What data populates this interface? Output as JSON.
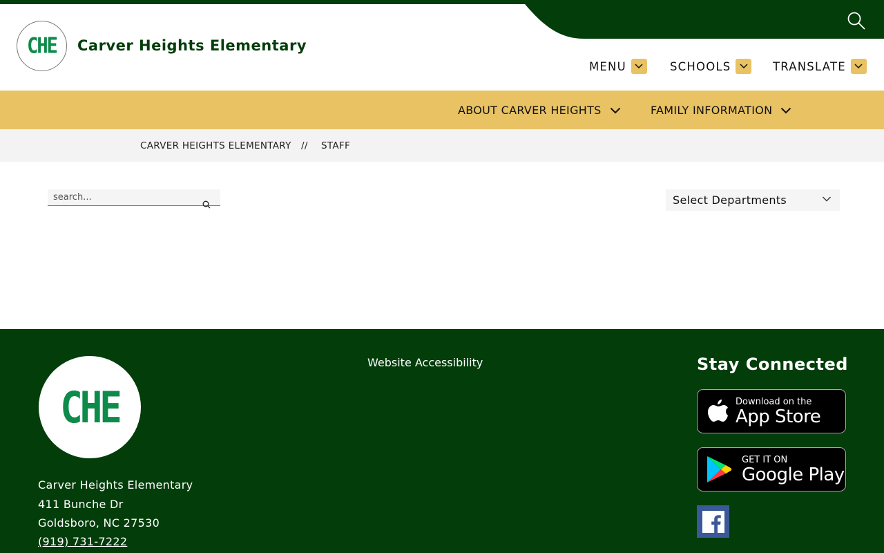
{
  "header": {
    "logo_text": "CHE",
    "school_name": "Carver Heights Elementary",
    "nav": [
      {
        "label": "MENU"
      },
      {
        "label": "SCHOOLS"
      },
      {
        "label": "TRANSLATE"
      }
    ]
  },
  "subnav": [
    {
      "label": "ABOUT CARVER HEIGHTS"
    },
    {
      "label": "FAMILY INFORMATION"
    }
  ],
  "breadcrumb": {
    "home": "CARVER HEIGHTS ELEMENTARY",
    "separator": "//",
    "current": "STAFF"
  },
  "search": {
    "placeholder": "search..."
  },
  "departments": {
    "selected": "Select Departments"
  },
  "footer": {
    "logo_text": "CHE",
    "address": {
      "name": "Carver Heights Elementary",
      "street": "411 Bunche Dr",
      "city": "Goldsboro, NC 27530",
      "phone": "(919) 731-7222"
    },
    "accessibility_link": "Website Accessibility",
    "stay_connected": "Stay Connected",
    "app_store": {
      "small": "Download on the",
      "big": "App Store"
    },
    "google_play": {
      "small": "GET IT ON",
      "big": "Google Play"
    },
    "social": [
      "facebook-icon"
    ]
  },
  "colors": {
    "brand_green": "#033d0a",
    "gold": "#e8c263",
    "logo_green": "#0d8b4a"
  }
}
